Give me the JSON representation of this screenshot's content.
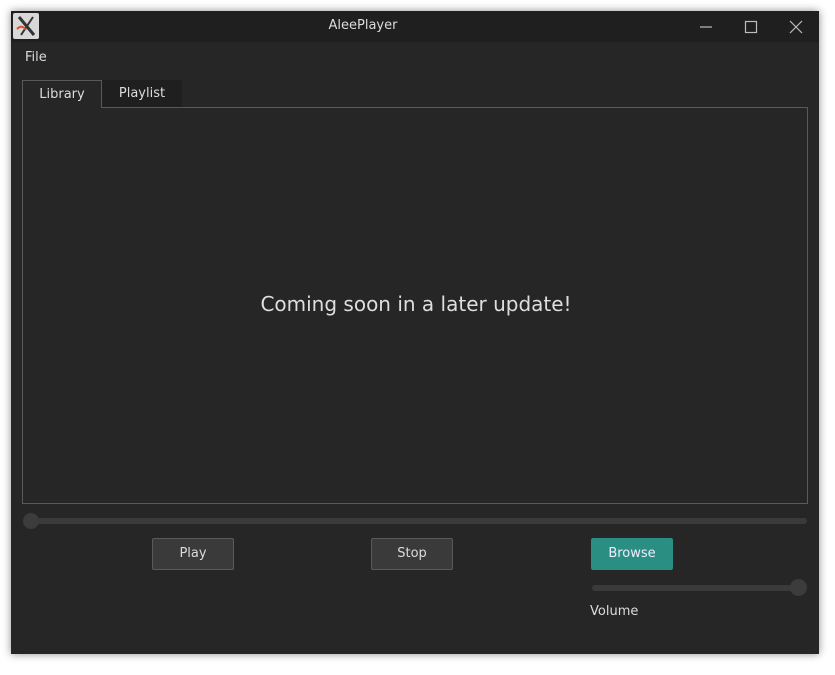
{
  "window": {
    "title": "AleePlayer",
    "icon": "x-logo-icon"
  },
  "menubar": {
    "items": [
      "File"
    ]
  },
  "tabs": [
    {
      "label": "Library",
      "selected": true
    },
    {
      "label": "Playlist",
      "selected": false
    }
  ],
  "library": {
    "message": "Coming soon in a later update!"
  },
  "seek": {
    "position": 0
  },
  "controls": {
    "play_label": "Play",
    "stop_label": "Stop",
    "browse_label": "Browse"
  },
  "volume": {
    "label": "Volume",
    "level": 1.0
  },
  "colors": {
    "background": "#262626",
    "titlebar": "#1f1f1f",
    "accent": "#2a8f82",
    "text": "#dcdcdc"
  }
}
